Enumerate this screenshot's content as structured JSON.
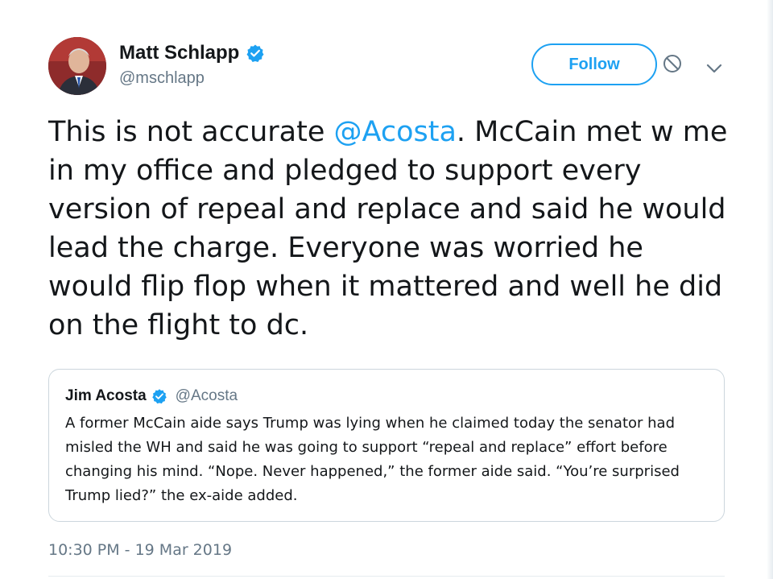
{
  "author": {
    "display_name": "Matt Schlapp",
    "handle": "@mschlapp",
    "verified_icon": "verified-badge-icon",
    "avatar_icon": "profile-photo"
  },
  "actions": {
    "follow_label": "Follow",
    "block_icon": "block-icon",
    "more_icon": "chevron-down-icon"
  },
  "tweet": {
    "text_before": "This is not accurate ",
    "mention": "@Acosta",
    "text_after": ". McCain met w me in my office and pledged to support every version of repeal and replace and said he would lead the charge. Everyone was worried he would flip flop when it mattered and well he did on the flight to dc.",
    "timestamp": "10:30 PM - 19 Mar 2019"
  },
  "quoted_tweet": {
    "display_name": "Jim Acosta",
    "handle": "@Acosta",
    "text": "A former McCain aide says Trump was lying when he claimed today the senator had misled the WH and said he was going to support “repeal and replace” effort before changing his mind. “Nope. Never happened,” the former aide said. “You’re surprised Trump lied?” the ex-aide added."
  },
  "colors": {
    "accent": "#1da1f2",
    "text": "#14171a",
    "secondary_text": "#657786",
    "border": "#ccd6dd"
  }
}
